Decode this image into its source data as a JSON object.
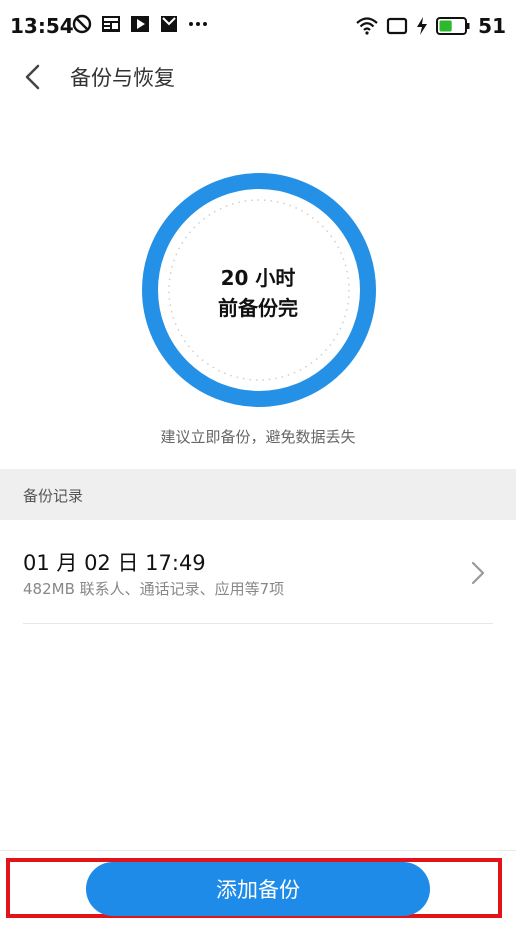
{
  "status_bar": {
    "time": "13:54",
    "battery_level": "51",
    "icons_left": [
      "do-not-disturb-icon",
      "news-icon",
      "play-icon",
      "mail-icon",
      "more-dots-icon"
    ],
    "icons_right": [
      "wifi-icon",
      "screen-icon",
      "charging-icon",
      "battery-icon"
    ],
    "battery_color": "#2db92d"
  },
  "header": {
    "title": "备份与恢复",
    "back_icon": "chevron-left-icon"
  },
  "status_ring": {
    "line1": "20 小时",
    "line2": "前备份完",
    "ring_color": "#2591e6"
  },
  "hint": "建议立即备份，避免数据丢失",
  "records_section": {
    "label": "备份记录",
    "items": [
      {
        "date": "01 月 02 日 17:49",
        "details": "482MB  联系人、通话记录、应用等7项"
      }
    ]
  },
  "add_button": {
    "label": "添加备份",
    "color": "#1e8be8"
  },
  "highlight_color": "#e2141a"
}
